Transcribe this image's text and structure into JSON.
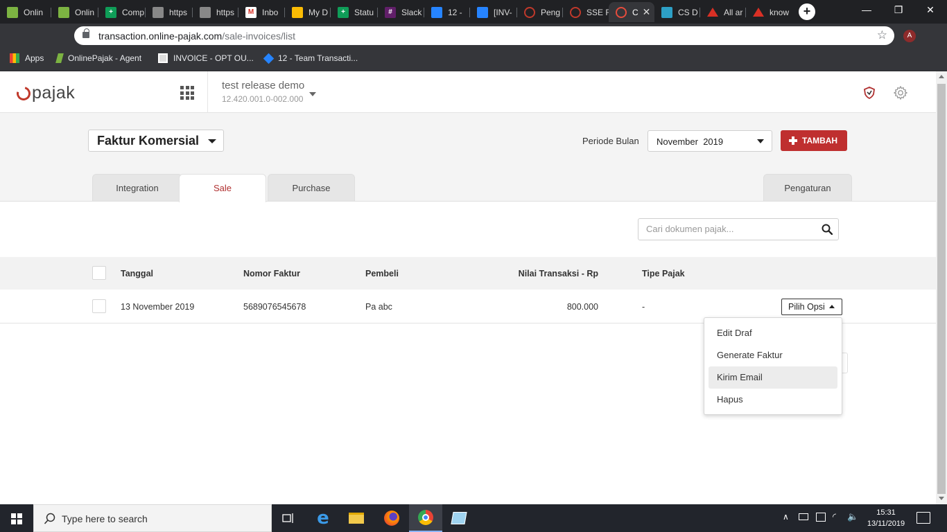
{
  "browser": {
    "tabs": [
      {
        "label": "Onlin",
        "icon": "onlinepajak-icon",
        "color": "#7cb342"
      },
      {
        "label": "Onlin",
        "icon": "onlinepajak-icon",
        "color": "#7cb342"
      },
      {
        "label": "Comp",
        "icon": "sheets-icon",
        "color": "#0f9d58"
      },
      {
        "label": "https",
        "icon": "page-icon",
        "color": "#888888"
      },
      {
        "label": "https",
        "icon": "page-icon",
        "color": "#888888"
      },
      {
        "label": "Inbo",
        "icon": "gmail-icon",
        "color": "#d93025"
      },
      {
        "label": "My D",
        "icon": "drive-icon",
        "color": "#fbbc04"
      },
      {
        "label": "Statu",
        "icon": "sheets-icon",
        "color": "#0f9d58"
      },
      {
        "label": "Slack",
        "icon": "slack-icon",
        "color": "#611f69"
      },
      {
        "label": "12 - ",
        "icon": "jira-icon",
        "color": "#2684ff"
      },
      {
        "label": "[INV-",
        "icon": "jira-icon",
        "color": "#2684ff"
      },
      {
        "label": "Peng",
        "icon": "onlinepajak-icon",
        "color": "#c0392b"
      },
      {
        "label": "SSE F",
        "icon": "onlinepajak-icon",
        "color": "#c0392b"
      },
      {
        "label": "C",
        "icon": "onlinepajak-icon",
        "color": "#c0392b"
      },
      {
        "label": "CS D",
        "icon": "confluence-icon",
        "color": "#2da0c6"
      },
      {
        "label": "All ar",
        "icon": "triangle-icon",
        "color": "#d93025"
      },
      {
        "label": "know",
        "icon": "triangle-icon",
        "color": "#d93025"
      }
    ],
    "url_host": "transaction.online-pajak.com",
    "url_path": "/sale-invoices/list",
    "profile_initial": "A",
    "bookmarks": [
      {
        "label": "Apps"
      },
      {
        "label": "OnlinePajak - Agent"
      },
      {
        "label": "INVOICE - OPT OU..."
      },
      {
        "label": "12 - Team Transacti..."
      }
    ]
  },
  "header": {
    "logo_text": "pajak",
    "company_name": "test release demo",
    "company_npwp": "12.420.001.0-002.000"
  },
  "toolbar": {
    "doc_type": "Faktur Komersial",
    "periode_label": "Periode Bulan",
    "periode_value": "November  2019",
    "add_label": "TAMBAH"
  },
  "tabs": {
    "integration": "Integration",
    "sale": "Sale",
    "purchase": "Purchase",
    "settings": "Pengaturan"
  },
  "search": {
    "placeholder": "Cari dokumen pajak..."
  },
  "table": {
    "columns": [
      "Tanggal",
      "Nomor Faktur",
      "Pembeli",
      "Nilai Transaksi - Rp",
      "Tipe Pajak"
    ],
    "rows": [
      {
        "tanggal": "13 November 2019",
        "nomor": "5689076545678",
        "pembeli": "Pa abc",
        "nilai": "800.000",
        "tipe": "-",
        "action": "Pilih Opsi"
      }
    ]
  },
  "menu": {
    "items": [
      "Edit Draf",
      "Generate Faktur",
      "Kirim Email",
      "Hapus"
    ],
    "highlighted": "Kirim Email"
  },
  "taskbar": {
    "search_text": "Type here to search",
    "time": "15:31",
    "date": "13/11/2019"
  },
  "colors": {
    "brand_red": "#bf2f2f",
    "active_tab_text": "#b03030"
  }
}
